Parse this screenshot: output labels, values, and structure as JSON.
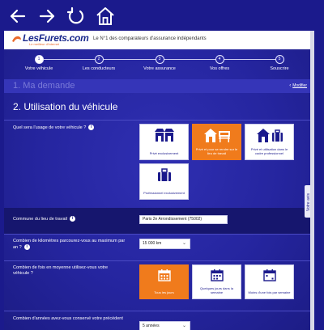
{
  "browser": {
    "back_icon": "arrow-left-icon",
    "forward_icon": "arrow-right-icon",
    "reload_icon": "reload-icon",
    "home_icon": "home-icon"
  },
  "header": {
    "logo_text": "LesFurets.com",
    "logo_sub": "Le meilleur d'internet",
    "tagline": "Le N°1 des comparateurs d'assurance indépendants"
  },
  "steps": [
    {
      "num": "1",
      "label": "Votre véhicule",
      "active": true
    },
    {
      "num": "2",
      "label": "Les conducteurs",
      "active": false
    },
    {
      "num": "3",
      "label": "Votre assurance",
      "active": false
    },
    {
      "num": "4",
      "label": "Vos offres",
      "active": false
    },
    {
      "num": "5",
      "label": "Souscrire",
      "active": false
    }
  ],
  "section1": {
    "title": "1. Ma demande",
    "modify_label": "Modifier"
  },
  "section2": {
    "title": "2. Utilisation du véhicule"
  },
  "q_usage": {
    "label": "Quel sera l'usage de votre véhicule ?",
    "info": "i",
    "options": [
      {
        "label": "Privé exclusivement",
        "icon": "shops-icon",
        "selected": false
      },
      {
        "label": "Privé et pour se rendre sur le lieu de travail",
        "icon": "home-office-icon",
        "selected": true
      },
      {
        "label": "Privé et utilisation dans le cadre professionnel",
        "icon": "home-briefcase-icon",
        "selected": false
      },
      {
        "label": "Professionnel exclusivement",
        "icon": "briefcase-icon",
        "selected": false
      }
    ]
  },
  "q_commune": {
    "label": "Commune du lieu de travail",
    "info": "i",
    "value": "Paris 2e Arrondissement (75002)"
  },
  "q_km": {
    "label": "Combien de kilomètres parcourez-vous au maximum par an ?",
    "info": "i",
    "value": "15 000 km"
  },
  "q_freq": {
    "label": "Combien de fois en moyenne utilisez-vous votre véhicule ?",
    "options": [
      {
        "label": "Tous les jours",
        "icon": "calendar-icon",
        "selected": true
      },
      {
        "label": "Quelques jours dans la semaine",
        "icon": "calendar-icon",
        "selected": false
      },
      {
        "label": "Moins d'une fois par semaine",
        "icon": "calendar-icon",
        "selected": false
      }
    ]
  },
  "q_years": {
    "label": "Combien d'années avez-vous conservé votre précédent",
    "value": "5 années"
  },
  "side_tab": {
    "label": "Votre avis"
  }
}
